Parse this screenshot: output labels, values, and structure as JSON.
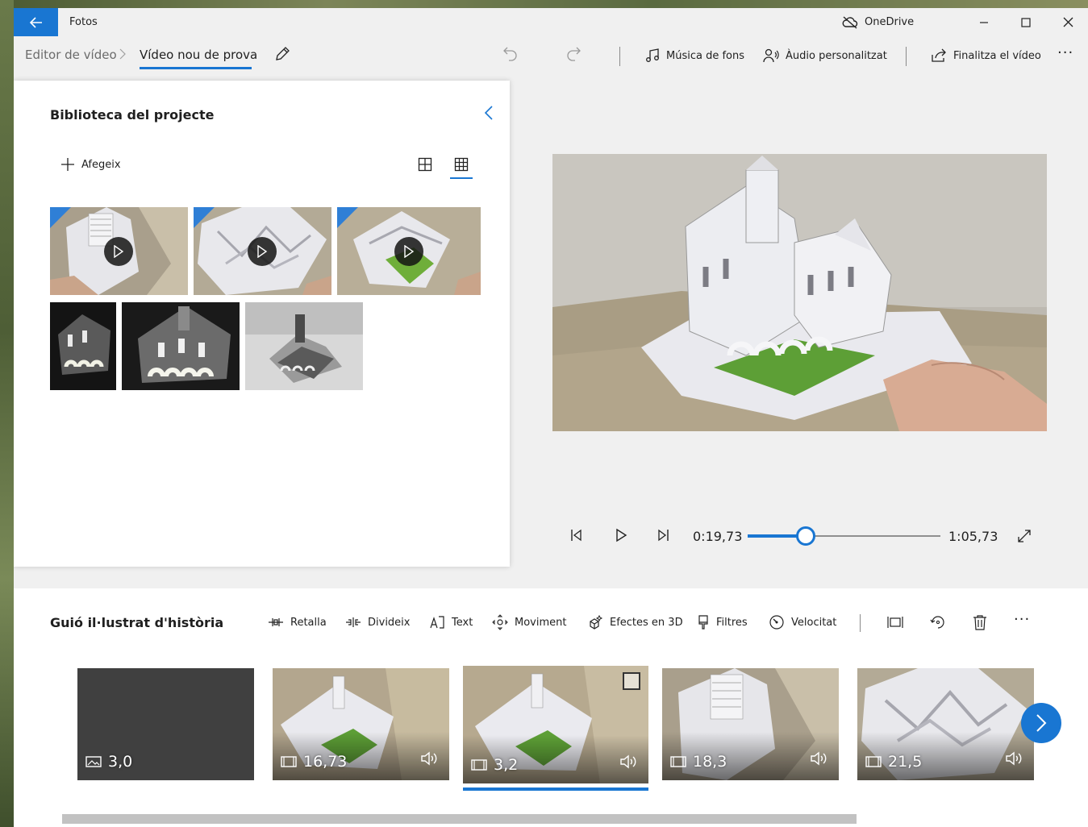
{
  "app": {
    "title": "Fotos",
    "onedrive_label": "OneDrive"
  },
  "breadcrumb": {
    "parent": "Editor de vídeo",
    "current": "Vídeo nou de prova"
  },
  "toolbar": {
    "background_music": "Música de fons",
    "custom_audio": "Àudio personalitzat",
    "finish_video": "Finalitza el vídeo",
    "more": "···"
  },
  "library": {
    "title": "Biblioteca del projecte",
    "add_label": "Afegeix",
    "items": [
      {
        "type": "video",
        "thumb": "pop-up cathedral top view"
      },
      {
        "type": "video",
        "thumb": "pop-up cathedral angled"
      },
      {
        "type": "video",
        "thumb": "pop-up cathedral green courtyard"
      },
      {
        "type": "image",
        "thumb": "lit cathedral dark"
      },
      {
        "type": "image",
        "thumb": "lit cathedral wide"
      },
      {
        "type": "image",
        "thumb": "cathedral grey"
      }
    ]
  },
  "player": {
    "current_time": "0:19,73",
    "total_time": "1:05,73",
    "progress": 0.3
  },
  "storyboard": {
    "title": "Guió il·lustrat d'història",
    "tools": {
      "trim": "Retalla",
      "split": "Divideix",
      "text": "Text",
      "motion": "Moviment",
      "effects3d": "Efectes en 3D",
      "filters": "Filtres",
      "speed": "Velocitat",
      "more": "···"
    },
    "clips": [
      {
        "duration": "3,0",
        "kind": "image",
        "audio": false
      },
      {
        "duration": "16,73",
        "kind": "video",
        "audio": true
      },
      {
        "duration": "3,2",
        "kind": "video",
        "audio": true,
        "selected": true
      },
      {
        "duration": "18,3",
        "kind": "video",
        "audio": true
      },
      {
        "duration": "21,5",
        "kind": "video",
        "audio": true
      }
    ]
  },
  "colors": {
    "accent": "#1976d2",
    "window_bg": "#f0f0f0",
    "panel_bg": "#ffffff"
  }
}
